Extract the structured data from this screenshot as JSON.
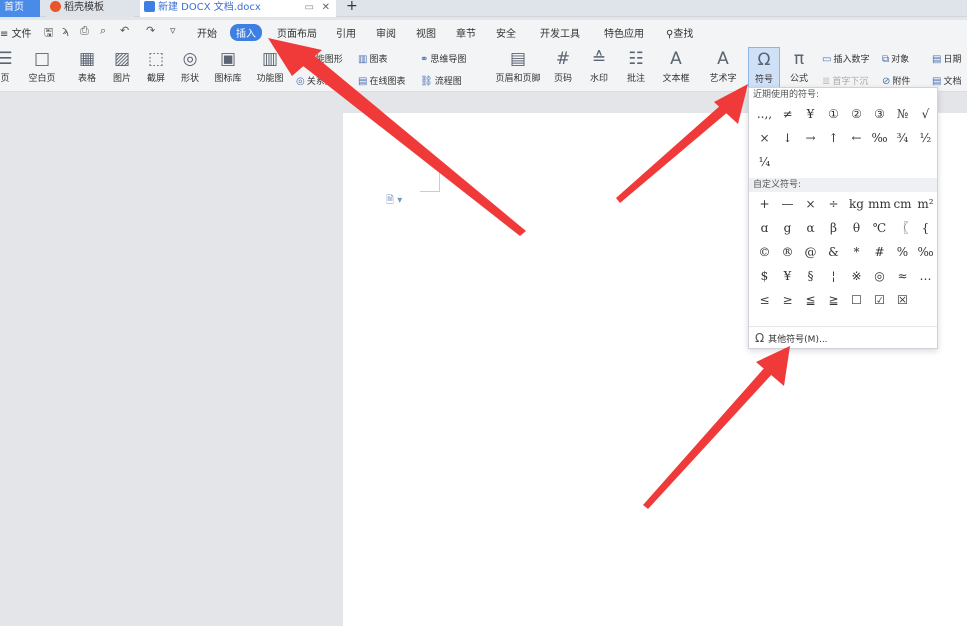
{
  "tabs": {
    "home": "首页",
    "template": "稻壳模板",
    "document": "新建 DOCX 文档.docx",
    "new_tab": "+"
  },
  "menu": {
    "file": "文件",
    "items": [
      "开始",
      "插入",
      "页面布局",
      "引用",
      "审阅",
      "视图",
      "章节",
      "安全",
      "开发工具",
      "特色应用"
    ],
    "search": "查找"
  },
  "ribbon": {
    "col1": [
      {
        "label": "页",
        "glyph": "☰"
      },
      {
        "label": "空白页",
        "glyph": "□"
      },
      {
        "label": "表格",
        "glyph": "▦"
      },
      {
        "label": "图片",
        "glyph": "▨"
      },
      {
        "label": "截屏",
        "glyph": "⬚"
      },
      {
        "label": "形状",
        "glyph": "◎"
      },
      {
        "label": "图标库",
        "glyph": "▣"
      },
      {
        "label": "功能图",
        "glyph": "▥"
      }
    ],
    "small_top": [
      "智能图形",
      "图表",
      "思维导图"
    ],
    "small_bottom": [
      "关系图",
      "在线图表",
      "流程图"
    ],
    "col2": [
      {
        "label": "页眉和页脚",
        "glyph": "▤"
      },
      {
        "label": "页码",
        "glyph": "#"
      },
      {
        "label": "水印",
        "glyph": "≙"
      },
      {
        "label": "批注",
        "glyph": "☷"
      },
      {
        "label": "文本框",
        "glyph": "A"
      },
      {
        "label": "艺术字",
        "glyph": "A"
      },
      {
        "label": "符号",
        "glyph": "Ω"
      },
      {
        "label": "公式",
        "glyph": "π"
      }
    ],
    "right_top": [
      "插入数字",
      "对象",
      "日期"
    ],
    "right_bottom": [
      "首字下沉",
      "附件",
      "文档"
    ]
  },
  "symbol_popup": {
    "recent_title": "近期使用的符号:",
    "recent": [
      "..,,",
      "≠",
      "¥",
      "①",
      "②",
      "③",
      "№",
      "√",
      "×",
      "↓",
      "→",
      "↑",
      "←",
      "‰",
      "¾",
      "½",
      "¼"
    ],
    "custom_title": "自定义符号:",
    "custom": [
      "+",
      "—",
      "×",
      "÷",
      "kg",
      "mm",
      "cm",
      "m²",
      "ɑ",
      "g",
      "α",
      "β",
      "θ",
      "℃",
      "〖",
      "{",
      "©",
      "®",
      "@",
      "&",
      "*",
      "#",
      "%",
      "‰",
      "$",
      "¥",
      "§",
      "¦",
      "※",
      "◎",
      "≈",
      "…",
      "≤",
      "≥",
      "≦",
      "≧",
      "☐",
      "☑",
      "☒"
    ],
    "more_label": "其他符号(M)..."
  }
}
